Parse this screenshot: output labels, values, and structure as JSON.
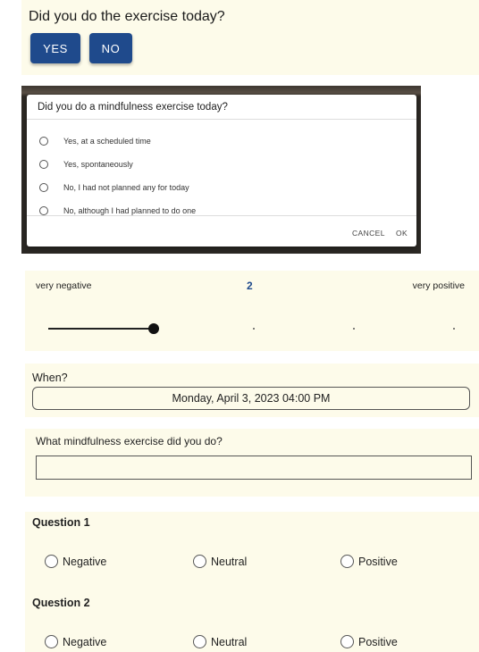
{
  "exercise_today": {
    "question": "Did you do the exercise today?",
    "yes_label": "YES",
    "no_label": "NO"
  },
  "dialog": {
    "title": "Did you do a mindfulness exercise today?",
    "options": [
      "Yes, at a scheduled time",
      "Yes, spontaneously",
      "No, I had not planned any for today",
      "No, although I had planned to do one"
    ],
    "cancel_label": "CANCEL",
    "ok_label": "OK"
  },
  "rating": {
    "min_label": "very negative",
    "max_label": "very positive",
    "value": "2",
    "slider_min": 1,
    "slider_max": 5,
    "slider_value": 2
  },
  "when": {
    "question": "When?",
    "value": "Monday, April 3, 2023 04:00 PM"
  },
  "exercise_type": {
    "question": "What mindfulness exercise did you do?",
    "value": ""
  },
  "questions": [
    {
      "title": "Question 1",
      "options": [
        "Negative",
        "Neutral",
        "Positive"
      ]
    },
    {
      "title": "Question 2",
      "options": [
        "Negative",
        "Neutral",
        "Positive"
      ]
    }
  ],
  "colors": {
    "accent": "#1f4a8c",
    "panel_background": "#fdfbea"
  }
}
